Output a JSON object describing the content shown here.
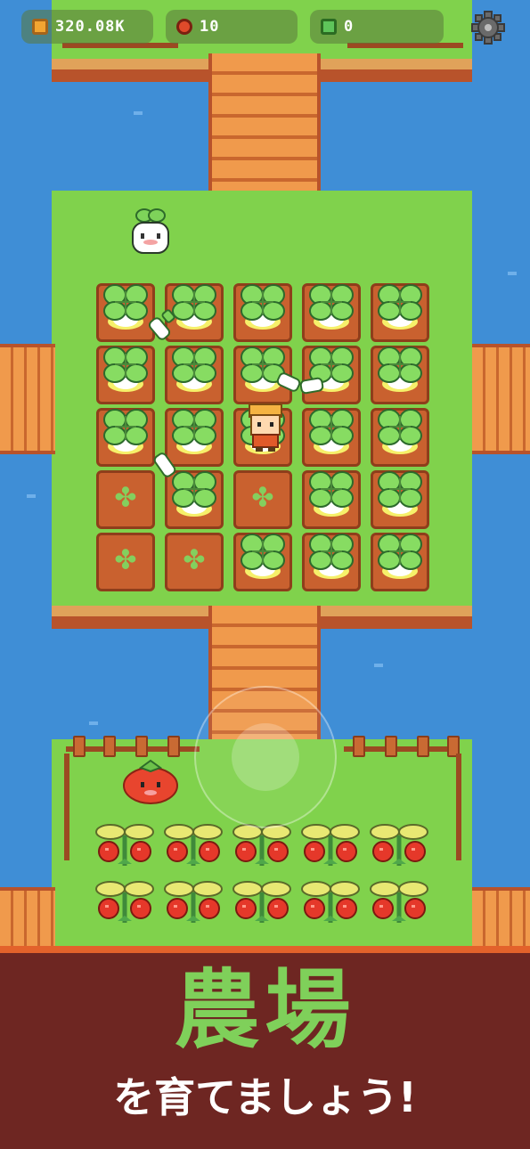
{
  "hud": {
    "coins": "320.08K",
    "tomatoes": "10",
    "gems": "0",
    "colors": {
      "coin": "#f2a532",
      "tomato": "#e04a2a",
      "gem": "#5ec45a"
    }
  },
  "icons": {
    "settings": "gear-icon",
    "coin": "coin-icon",
    "tomato": "tomato-icon",
    "gem": "gem-icon"
  },
  "farm": {
    "turnip_field": {
      "rows": [
        [
          "grown",
          "grown",
          "grown",
          "grown",
          "grown"
        ],
        [
          "grown",
          "grown",
          "grown",
          "grown",
          "grown"
        ],
        [
          "grown",
          "grown",
          "grown",
          "grown",
          "grown"
        ],
        [
          "seedling",
          "grown",
          "seedling",
          "grown",
          "grown"
        ],
        [
          "seedling",
          "seedling",
          "grown",
          "grown",
          "grown"
        ]
      ]
    },
    "tomato_field": {
      "rows": [
        [
          "tomato",
          "tomato",
          "tomato",
          "tomato",
          "tomato"
        ],
        [
          "tomato",
          "tomato",
          "tomato",
          "tomato",
          "tomato"
        ]
      ]
    }
  },
  "banner": {
    "title": "農場",
    "subtitle": "を育てましょう!",
    "colors": {
      "background": "#6e2622",
      "title": "#7fd05a",
      "accent": "#e3622b"
    }
  }
}
